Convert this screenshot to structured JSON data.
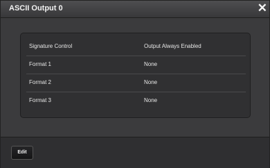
{
  "dialog": {
    "title": "ASCII Output 0",
    "close_symbol": "✕"
  },
  "table": {
    "rows": [
      {
        "label": "Signature Control",
        "value": "Output Always Enabled"
      },
      {
        "label": "Format 1",
        "value": "None"
      },
      {
        "label": "Format 2",
        "value": "None"
      },
      {
        "label": "Format 3",
        "value": "None"
      }
    ]
  },
  "footer": {
    "edit_label": "Edit"
  }
}
